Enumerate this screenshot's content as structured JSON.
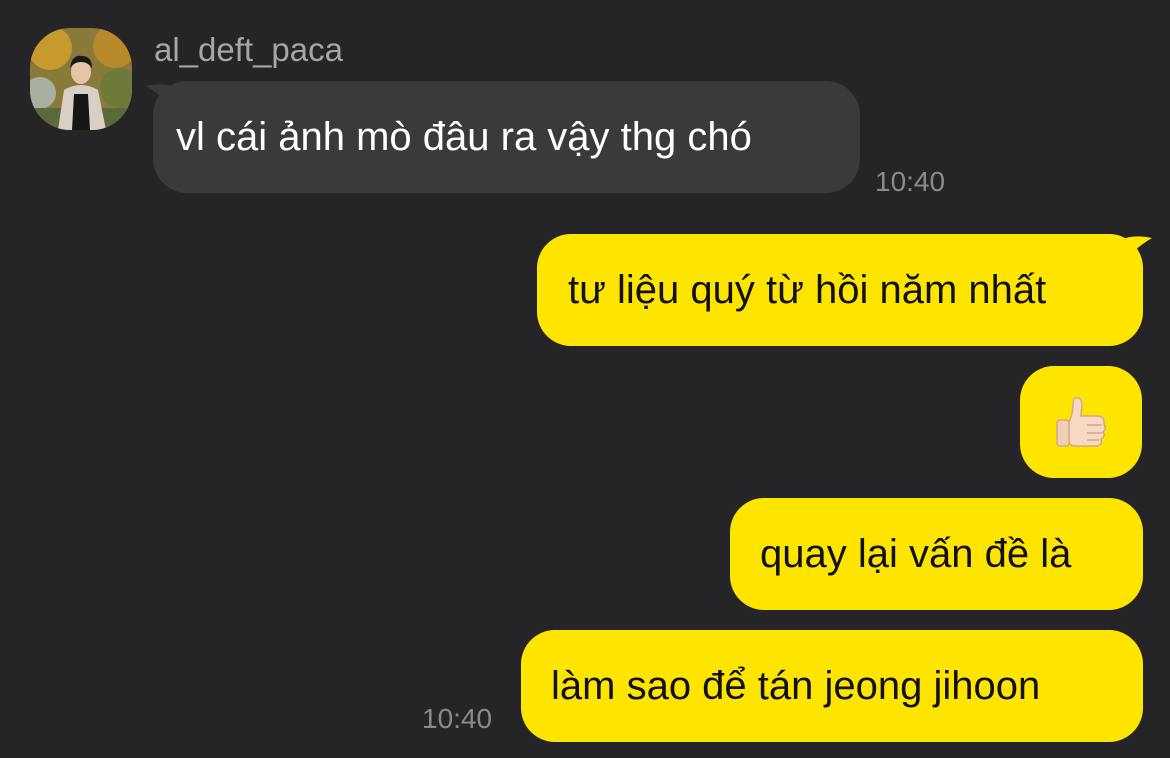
{
  "sender": {
    "username": "al_deft_paca",
    "avatar_icon": "profile-photo-icon"
  },
  "messages": {
    "incoming_1": {
      "text": "vl cái ảnh mò đâu ra vậy thg chó",
      "time": "10:40"
    },
    "outgoing_1": {
      "text": "tư liệu quý từ hồi năm nhất"
    },
    "outgoing_2": {
      "emoji": "thumbs-up-icon"
    },
    "outgoing_3": {
      "text": "quay lại vấn đề là"
    },
    "outgoing_4": {
      "text": "làm sao để tán jeong jihoon",
      "time": "10:40"
    }
  },
  "colors": {
    "background": "#252527",
    "incoming_bubble": "#3a3a3c",
    "outgoing_bubble": "#fee500",
    "timestamp": "#8a8a8e",
    "username": "#a6a6aa"
  }
}
